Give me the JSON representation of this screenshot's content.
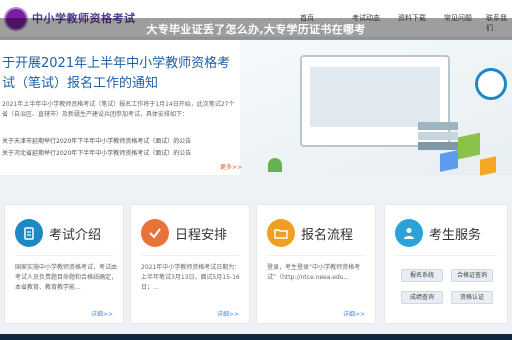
{
  "header": {
    "site_title": "中小学教师资格考试",
    "nav": [
      "首页",
      "考试动态",
      "资料下载",
      "常见问题",
      "联系我们"
    ]
  },
  "overlay": {
    "title": "大专毕业证丢了怎么办,大专学历证书在哪考"
  },
  "banner": {
    "notice_title": "于开展2021年上半年中小学教师资格考试（笔试）报名工作的通知",
    "notice_body": "2021年上半年中小学教师资格考试（笔试）报名工作将于1月14日开始，此次笔试27个省（自治区、直辖市）及新疆生产建设兵团参加考试，具体安排如下：",
    "links": [
      "关于天津市延期举行2020年下半年中小学教师资格考试（面试）的公告",
      "关于河北省延期举行2020年下半年中小学教师资格考试（面试）的公告"
    ],
    "more": "更多>>"
  },
  "cards": [
    {
      "title": "考试介绍",
      "icon": "clipboard-icon",
      "color": "#1e88c7",
      "text": "国家实施中小学教师资格考试，考试由考试人员负责题目命题和合格线确定，本省教育、教育教学能...",
      "more": "详细>>"
    },
    {
      "title": "日程安排",
      "icon": "checkmark-icon",
      "color": "#e8733a",
      "text": "2021年中小学教师资格考试日期为：上半年笔试3月13日，面试5月15-16日；...",
      "more": "详细>>"
    },
    {
      "title": "报名流程",
      "icon": "folder-icon",
      "color": "#f0a020",
      "text": "登录，考生登录“中小学教师资格考试”（http://ntce.neea.edu...",
      "more": "详细>>"
    },
    {
      "title": "考生服务",
      "icon": "person-icon",
      "color": "#29a3d8",
      "buttons": [
        "报名系统",
        "合格证查询",
        "成绩查询",
        "资格认证"
      ]
    }
  ]
}
